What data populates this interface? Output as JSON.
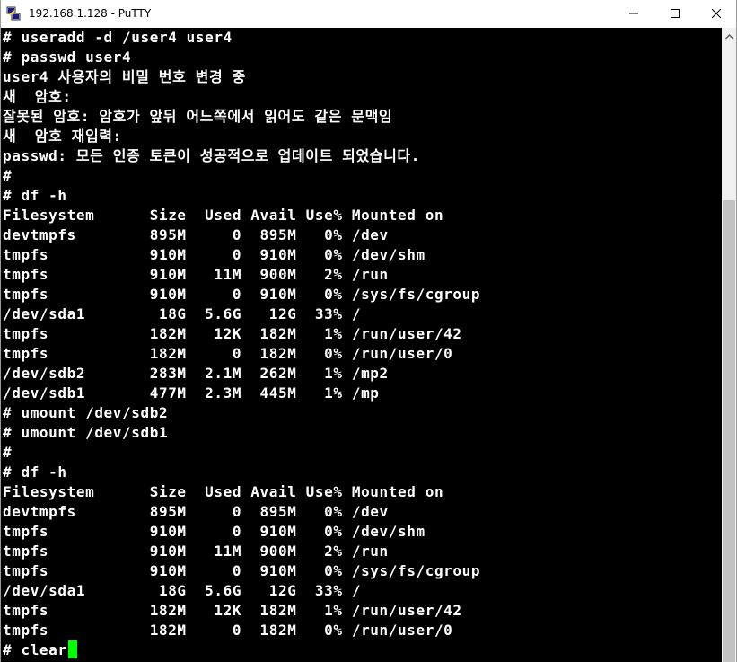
{
  "window": {
    "title": "192.168.1.128 - PuTTY"
  },
  "icons": {
    "app": "putty-icon",
    "minimize": "minimize-icon",
    "maximize": "maximize-icon",
    "close": "close-icon",
    "scroll_up": "chevron-up-icon"
  },
  "colors": {
    "terminal_background": "#000000",
    "terminal_text": "#ffffff",
    "cursor": "#00ff00",
    "scrollbar_track": "#f0f0f0",
    "scrollbar_thumb": "#c2c2c2"
  },
  "terminal": {
    "lines": [
      "# useradd -d /user4 user4",
      "# passwd user4",
      "user4 사용자의 비밀 번호 변경 중",
      "새  암호:",
      "잘못된 암호: 암호가 앞뒤 어느쪽에서 읽어도 같은 문맥임",
      "새  암호 재입력:",
      "passwd: 모든 인증 토큰이 성공적으로 업데이트 되었습니다.",
      "#",
      "# df -h",
      "Filesystem      Size  Used Avail Use% Mounted on",
      "devtmpfs        895M     0  895M   0% /dev",
      "tmpfs           910M     0  910M   0% /dev/shm",
      "tmpfs           910M   11M  900M   2% /run",
      "tmpfs           910M     0  910M   0% /sys/fs/cgroup",
      "/dev/sda1        18G  5.6G   12G  33% /",
      "tmpfs           182M   12K  182M   1% /run/user/42",
      "tmpfs           182M     0  182M   0% /run/user/0",
      "/dev/sdb2       283M  2.1M  262M   1% /mp2",
      "/dev/sdb1       477M  2.3M  445M   1% /mp",
      "# umount /dev/sdb2",
      "# umount /dev/sdb1",
      "#",
      "# df -h",
      "Filesystem      Size  Used Avail Use% Mounted on",
      "devtmpfs        895M     0  895M   0% /dev",
      "tmpfs           910M     0  910M   0% /dev/shm",
      "tmpfs           910M   11M  900M   2% /run",
      "tmpfs           910M     0  910M   0% /sys/fs/cgroup",
      "/dev/sda1        18G  5.6G   12G  33% /",
      "tmpfs           182M   12K  182M   1% /run/user/42",
      "tmpfs           182M     0  182M   0% /run/user/0",
      "# clear"
    ]
  }
}
